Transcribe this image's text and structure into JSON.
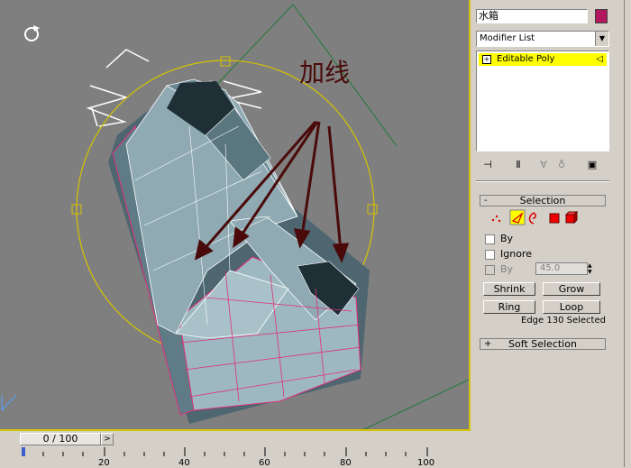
{
  "viewport": {
    "annotation_text": "加线"
  },
  "timeline": {
    "frame_display": "0 / 100",
    "next_glyph": ">",
    "ruler_labels": [
      "20",
      "40",
      "60",
      "80",
      "100"
    ]
  },
  "command_panel": {
    "object_name": "水箱",
    "object_color": "#b0175c",
    "modifier_list": "Modifier List",
    "stack": {
      "item_label": "Editable Poly",
      "expand_glyph": "+"
    },
    "selection": {
      "title": "Selection",
      "options": {
        "by_vertex": "By",
        "ignore_backfacing": "Ignore",
        "by_angle": "By",
        "angle_value": "45.0"
      },
      "buttons": {
        "shrink": "Shrink",
        "grow": "Grow",
        "ring": "Ring",
        "loop": "Loop"
      },
      "status": "Edge 130 Selected"
    },
    "soft_selection": {
      "title": "Soft Selection",
      "expand_glyph": "+"
    },
    "selection_collapse_glyph": "-"
  },
  "colors": {
    "viewport_bg": "#7f7f7f",
    "active_border": "#d6c300",
    "stack_highlight": "#ffff00",
    "mesh_fill": "#8faab3",
    "selected_edge": "#e0307a"
  }
}
